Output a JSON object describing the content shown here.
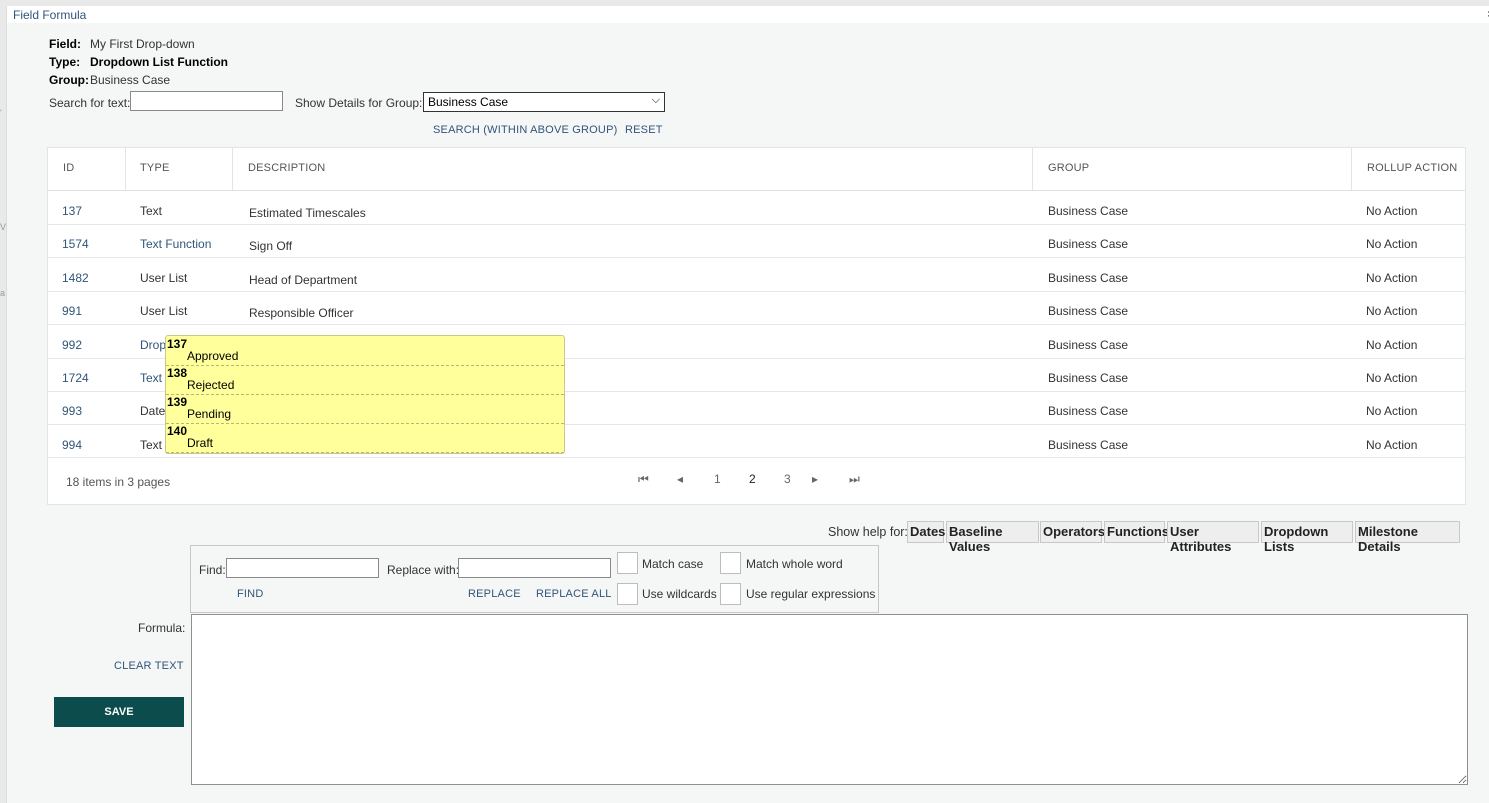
{
  "window": {
    "title": "Field Formula",
    "close": "×"
  },
  "field_info": {
    "field_label": "Field:",
    "field_value": "My First Drop-down",
    "type_label": "Type:",
    "type_value": "Dropdown List Function",
    "group_label": "Group:",
    "group_value": "Business Case"
  },
  "search": {
    "label": "Search for text:",
    "value": "",
    "group_label": "Show Details for Group:",
    "group_selected": "Business Case",
    "search_link": "SEARCH (WITHIN ABOVE GROUP)",
    "reset_link": "RESET"
  },
  "grid": {
    "headers": [
      "ID",
      "TYPE",
      "DESCRIPTION",
      "GROUP",
      "ROLLUP ACTION"
    ],
    "rows": [
      {
        "id": "137",
        "type": "Text",
        "desc": "Estimated Timescales",
        "group": "Business Case",
        "rollup": "No Action"
      },
      {
        "id": "1574",
        "type": "Text Function",
        "desc": "Sign Off",
        "group": "Business Case",
        "rollup": "No Action"
      },
      {
        "id": "1482",
        "type": "User List",
        "desc": "Head of Department",
        "group": "Business Case",
        "rollup": "No Action"
      },
      {
        "id": "991",
        "type": "User List",
        "desc": "Responsible Officer",
        "group": "Business Case",
        "rollup": "No Action"
      },
      {
        "id": "992",
        "type": "Drop",
        "desc": "",
        "group": "Business Case",
        "rollup": "No Action"
      },
      {
        "id": "1724",
        "type": "Text",
        "desc": "",
        "group": "Business Case",
        "rollup": "No Action"
      },
      {
        "id": "993",
        "type": "Date",
        "desc": "",
        "group": "Business Case",
        "rollup": "No Action"
      },
      {
        "id": "994",
        "type": "Text",
        "desc": "",
        "group": "Business Case",
        "rollup": "No Action"
      }
    ],
    "pager": {
      "info": "18 items in 3 pages",
      "first": "⏮",
      "prev": "◂",
      "pages": [
        "1",
        "2",
        "3"
      ],
      "next": "▸",
      "last": "⏭"
    }
  },
  "tooltip": {
    "items": [
      {
        "id": "137",
        "label": "Approved"
      },
      {
        "id": "138",
        "label": "Rejected"
      },
      {
        "id": "139",
        "label": "Pending"
      },
      {
        "id": "140",
        "label": "Draft"
      }
    ]
  },
  "help": {
    "label": "Show help for:",
    "buttons": [
      "Dates",
      "Baseline Values",
      "Operators",
      "Functions",
      "User Attributes",
      "Dropdown Lists",
      "Milestone Details"
    ]
  },
  "find_replace": {
    "find_label": "Find:",
    "find_value": "",
    "replace_label": "Replace with:",
    "replace_value": "",
    "match_case": "Match case",
    "match_whole": "Match whole word",
    "use_wildcards": "Use wildcards",
    "use_regex": "Use regular expressions",
    "find_link": "FIND",
    "replace_link": "REPLACE",
    "replace_all_link": "REPLACE ALL"
  },
  "formula": {
    "label": "Formula:",
    "value": "",
    "clear_link": "CLEAR TEXT",
    "save_label": "SAVE"
  }
}
